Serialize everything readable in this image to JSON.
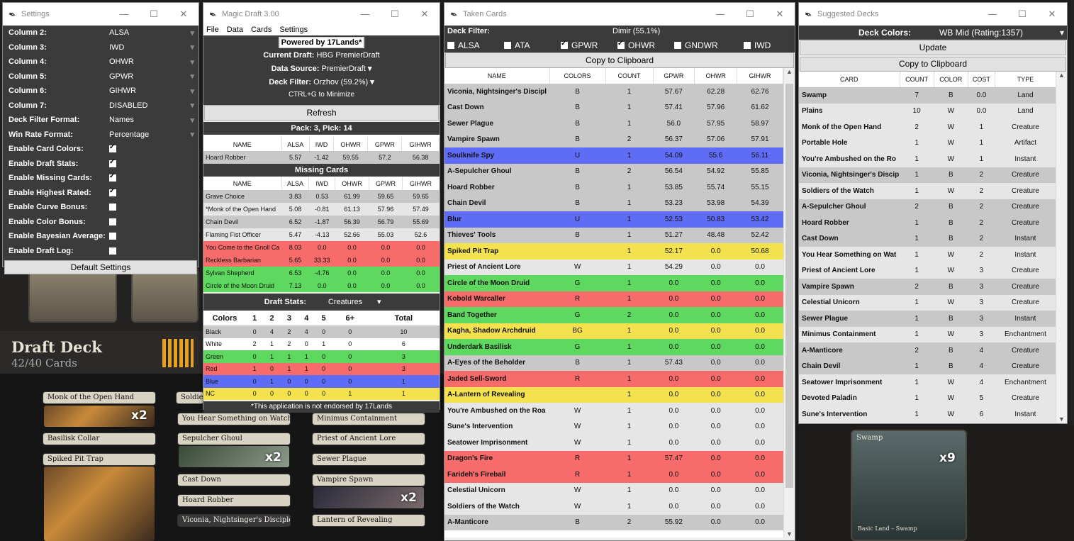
{
  "settings": {
    "title": "Settings",
    "rows": [
      {
        "k": "Column 2:",
        "v": "ALSA"
      },
      {
        "k": "Column 3:",
        "v": "IWD"
      },
      {
        "k": "Column 4:",
        "v": "OHWR"
      },
      {
        "k": "Column 5:",
        "v": "GPWR"
      },
      {
        "k": "Column 6:",
        "v": "GIHWR"
      },
      {
        "k": "Column 7:",
        "v": "DISABLED"
      },
      {
        "k": "Deck Filter Format:",
        "v": "Names"
      },
      {
        "k": "Win Rate Format:",
        "v": "Percentage"
      }
    ],
    "checks": [
      {
        "k": "Enable Card Colors:",
        "on": true
      },
      {
        "k": "Enable Draft Stats:",
        "on": true
      },
      {
        "k": "Enable Missing Cards:",
        "on": true
      },
      {
        "k": "Enable Highest Rated:",
        "on": true
      },
      {
        "k": "Enable Curve Bonus:",
        "on": false
      },
      {
        "k": "Enable Color Bonus:",
        "on": false
      },
      {
        "k": "Enable Bayesian Average:",
        "on": false
      },
      {
        "k": "Enable Draft Log:",
        "on": false
      }
    ],
    "default_button": "Default Settings"
  },
  "magic": {
    "title": "Magic Draft 3.00",
    "menu": [
      "File",
      "Data",
      "Cards",
      "Settings"
    ],
    "powered": "Powered by 17Lands*",
    "current_draft_label": "Current Draft:",
    "current_draft": "HBG PremierDraft",
    "data_source_label": "Data Source:",
    "data_source": "PremierDraft",
    "deck_filter_label": "Deck Filter:",
    "deck_filter": "Orzhov (59.2%)",
    "minimize_hint": "CTRL+G to Minimize",
    "refresh": "Refresh",
    "pack_pick": "Pack: 3, Pick: 14",
    "headers": [
      "NAME",
      "ALSA",
      "IWD",
      "OHWR",
      "GPWR",
      "GIHWR"
    ],
    "pack_rows": [
      {
        "c": "gray",
        "v": [
          "Hoard Robber",
          "5.57",
          "-1.42",
          "59.55",
          "57.2",
          "56.38"
        ]
      }
    ],
    "missing_title": "Missing Cards",
    "missing_rows": [
      {
        "c": "gray",
        "v": [
          "Grave Choice",
          "3.83",
          "0.53",
          "61.99",
          "59.65",
          "59.65"
        ]
      },
      {
        "c": "lg",
        "v": [
          "*Monk of the Open Hand",
          "5.08",
          "-0.81",
          "61.13",
          "57.96",
          "57.49"
        ]
      },
      {
        "c": "gray",
        "v": [
          "Chain Devil",
          "6.52",
          "-1.87",
          "56.39",
          "56.79",
          "55.69"
        ]
      },
      {
        "c": "lg",
        "v": [
          "Flaming Fist Officer",
          "5.47",
          "-4.13",
          "52.66",
          "55.03",
          "52.6"
        ]
      },
      {
        "c": "red",
        "v": [
          "You Come to the Gnoll Ca",
          "8.03",
          "0.0",
          "0.0",
          "0.0",
          "0.0"
        ]
      },
      {
        "c": "red",
        "v": [
          "Reckless Barbarian",
          "5.65",
          "33.33",
          "0.0",
          "0.0",
          "0.0"
        ]
      },
      {
        "c": "grn",
        "v": [
          "Sylvan Shepherd",
          "6.53",
          "-4.76",
          "0.0",
          "0.0",
          "0.0"
        ]
      },
      {
        "c": "grn",
        "v": [
          "Circle of the Moon Druid",
          "7.13",
          "0.0",
          "0.0",
          "0.0",
          "0.0"
        ]
      }
    ],
    "stats_label": "Draft Stats:",
    "stats_filter": "Creatures",
    "stats_headers": [
      "Colors",
      "1",
      "2",
      "3",
      "4",
      "5",
      "6+",
      "Total"
    ],
    "stats_rows": [
      {
        "c": "gray",
        "v": [
          "Black",
          "0",
          "4",
          "2",
          "4",
          "0",
          "0",
          "10"
        ]
      },
      {
        "c": "wh",
        "v": [
          "White",
          "2",
          "1",
          "2",
          "0",
          "1",
          "0",
          "6"
        ]
      },
      {
        "c": "grn",
        "v": [
          "Green",
          "0",
          "1",
          "1",
          "1",
          "0",
          "0",
          "3"
        ]
      },
      {
        "c": "red",
        "v": [
          "Red",
          "1",
          "0",
          "1",
          "1",
          "0",
          "0",
          "3"
        ]
      },
      {
        "c": "blu",
        "v": [
          "Blue",
          "0",
          "1",
          "0",
          "0",
          "0",
          "0",
          "1"
        ]
      },
      {
        "c": "yel",
        "v": [
          "NC",
          "0",
          "0",
          "0",
          "0",
          "0",
          "1",
          "1"
        ]
      }
    ],
    "footer": "*This application is not endorsed by 17Lands"
  },
  "taken": {
    "title": "Taken Cards",
    "deck_filter_label": "Deck Filter:",
    "deck_filter": "Dimir (55.1%)",
    "toggles": [
      {
        "k": "ALSA",
        "on": false
      },
      {
        "k": "ATA",
        "on": false
      },
      {
        "k": "GPWR",
        "on": true
      },
      {
        "k": "OHWR",
        "on": true
      },
      {
        "k": "GNDWR",
        "on": false
      },
      {
        "k": "IWD",
        "on": false
      }
    ],
    "copy": "Copy to Clipboard",
    "headers": [
      "NAME",
      "COLORS",
      "COUNT",
      "GPWR",
      "OHWR",
      "GIHWR"
    ],
    "rows": [
      {
        "c": "gray",
        "v": [
          "Viconia, Nightsinger's Discipl",
          "B",
          "1",
          "57.67",
          "62.28",
          "62.76"
        ]
      },
      {
        "c": "gray",
        "v": [
          "Cast Down",
          "B",
          "1",
          "57.41",
          "57.96",
          "61.62"
        ]
      },
      {
        "c": "gray",
        "v": [
          "Sewer Plague",
          "B",
          "1",
          "56.0",
          "57.95",
          "58.97"
        ]
      },
      {
        "c": "gray",
        "v": [
          "Vampire Spawn",
          "B",
          "2",
          "56.37",
          "57.06",
          "57.91"
        ]
      },
      {
        "c": "blu",
        "v": [
          "Soulknife Spy",
          "U",
          "1",
          "54.09",
          "55.6",
          "56.11"
        ]
      },
      {
        "c": "gray",
        "v": [
          "A-Sepulcher Ghoul",
          "B",
          "2",
          "56.54",
          "54.92",
          "55.85"
        ]
      },
      {
        "c": "gray",
        "v": [
          "Hoard Robber",
          "B",
          "1",
          "53.85",
          "55.74",
          "55.15"
        ]
      },
      {
        "c": "gray",
        "v": [
          "Chain Devil",
          "B",
          "1",
          "53.23",
          "53.98",
          "54.39"
        ]
      },
      {
        "c": "blu",
        "v": [
          "Blur",
          "U",
          "1",
          "52.53",
          "50.83",
          "53.42"
        ]
      },
      {
        "c": "gray",
        "v": [
          "Thieves' Tools",
          "B",
          "1",
          "51.27",
          "48.48",
          "52.42"
        ]
      },
      {
        "c": "yel",
        "v": [
          "Spiked Pit Trap",
          "",
          "1",
          "52.17",
          "0.0",
          "50.68"
        ]
      },
      {
        "c": "lg",
        "v": [
          "Priest of Ancient Lore",
          "W",
          "1",
          "54.29",
          "0.0",
          "0.0"
        ]
      },
      {
        "c": "grn",
        "v": [
          "Circle of the Moon Druid",
          "G",
          "1",
          "0.0",
          "0.0",
          "0.0"
        ]
      },
      {
        "c": "red",
        "v": [
          "Kobold Warcaller",
          "R",
          "1",
          "0.0",
          "0.0",
          "0.0"
        ]
      },
      {
        "c": "grn",
        "v": [
          "Band Together",
          "G",
          "2",
          "0.0",
          "0.0",
          "0.0"
        ]
      },
      {
        "c": "yel",
        "v": [
          "Kagha, Shadow Archdruid",
          "BG",
          "1",
          "0.0",
          "0.0",
          "0.0"
        ]
      },
      {
        "c": "grn",
        "v": [
          "Underdark Basilisk",
          "G",
          "1",
          "0.0",
          "0.0",
          "0.0"
        ]
      },
      {
        "c": "gray",
        "v": [
          "A-Eyes of the Beholder",
          "B",
          "1",
          "57.43",
          "0.0",
          "0.0"
        ]
      },
      {
        "c": "red",
        "v": [
          "Jaded Sell-Sword",
          "R",
          "1",
          "0.0",
          "0.0",
          "0.0"
        ]
      },
      {
        "c": "yel",
        "v": [
          "A-Lantern of Revealing",
          "",
          "1",
          "0.0",
          "0.0",
          "0.0"
        ]
      },
      {
        "c": "lg",
        "v": [
          "You're Ambushed on the Roa",
          "W",
          "1",
          "0.0",
          "0.0",
          "0.0"
        ]
      },
      {
        "c": "lg",
        "v": [
          "Sune's Intervention",
          "W",
          "1",
          "0.0",
          "0.0",
          "0.0"
        ]
      },
      {
        "c": "lg",
        "v": [
          "Seatower Imprisonment",
          "W",
          "1",
          "0.0",
          "0.0",
          "0.0"
        ]
      },
      {
        "c": "red",
        "v": [
          "Dragon's Fire",
          "R",
          "1",
          "57.47",
          "0.0",
          "0.0"
        ]
      },
      {
        "c": "red",
        "v": [
          "Farideh's Fireball",
          "R",
          "1",
          "0.0",
          "0.0",
          "0.0"
        ]
      },
      {
        "c": "lg",
        "v": [
          "Celestial Unicorn",
          "W",
          "1",
          "0.0",
          "0.0",
          "0.0"
        ]
      },
      {
        "c": "lg",
        "v": [
          "Soldiers of the Watch",
          "W",
          "1",
          "0.0",
          "0.0",
          "0.0"
        ]
      },
      {
        "c": "gray",
        "v": [
          "A-Manticore",
          "B",
          "2",
          "55.92",
          "0.0",
          "0.0"
        ]
      }
    ]
  },
  "suggested": {
    "title": "Suggested Decks",
    "colors_label": "Deck Colors:",
    "colors": "WB Mid (Rating:1357)",
    "update": "Update",
    "copy": "Copy to Clipboard",
    "headers": [
      "CARD",
      "COUNT",
      "COLOR",
      "COST",
      "TYPE"
    ],
    "rows": [
      {
        "c": "gray",
        "v": [
          "Swamp",
          "7",
          "B",
          "0.0",
          "Land"
        ]
      },
      {
        "c": "lg",
        "v": [
          "Plains",
          "10",
          "W",
          "0.0",
          "Land"
        ]
      },
      {
        "c": "lg",
        "v": [
          "Monk of the Open Hand",
          "2",
          "W",
          "1",
          "Creature"
        ]
      },
      {
        "c": "lg",
        "v": [
          "Portable Hole",
          "1",
          "W",
          "1",
          "Artifact"
        ]
      },
      {
        "c": "lg",
        "v": [
          "You're Ambushed on the Ro",
          "1",
          "W",
          "1",
          "Instant"
        ]
      },
      {
        "c": "gray",
        "v": [
          "Viconia, Nightsinger's Discip",
          "1",
          "B",
          "2",
          "Creature"
        ]
      },
      {
        "c": "lg",
        "v": [
          "Soldiers of the Watch",
          "1",
          "W",
          "2",
          "Creature"
        ]
      },
      {
        "c": "gray",
        "v": [
          "A-Sepulcher Ghoul",
          "2",
          "B",
          "2",
          "Creature"
        ]
      },
      {
        "c": "gray",
        "v": [
          "Hoard Robber",
          "1",
          "B",
          "2",
          "Creature"
        ]
      },
      {
        "c": "gray",
        "v": [
          "Cast Down",
          "1",
          "B",
          "2",
          "Instant"
        ]
      },
      {
        "c": "lg",
        "v": [
          "You Hear Something on Wat",
          "1",
          "W",
          "2",
          "Instant"
        ]
      },
      {
        "c": "lg",
        "v": [
          "Priest of Ancient Lore",
          "1",
          "W",
          "3",
          "Creature"
        ]
      },
      {
        "c": "gray",
        "v": [
          "Vampire Spawn",
          "2",
          "B",
          "3",
          "Creature"
        ]
      },
      {
        "c": "lg",
        "v": [
          "Celestial Unicorn",
          "1",
          "W",
          "3",
          "Creature"
        ]
      },
      {
        "c": "gray",
        "v": [
          "Sewer Plague",
          "1",
          "B",
          "3",
          "Instant"
        ]
      },
      {
        "c": "lg",
        "v": [
          "Minimus Containment",
          "1",
          "W",
          "3",
          "Enchantment"
        ]
      },
      {
        "c": "gray",
        "v": [
          "A-Manticore",
          "2",
          "B",
          "4",
          "Creature"
        ]
      },
      {
        "c": "gray",
        "v": [
          "Chain Devil",
          "1",
          "B",
          "4",
          "Creature"
        ]
      },
      {
        "c": "lg",
        "v": [
          "Seatower Imprisonment",
          "1",
          "W",
          "4",
          "Enchantment"
        ]
      },
      {
        "c": "lg",
        "v": [
          "Devoted Paladin",
          "1",
          "W",
          "5",
          "Creature"
        ]
      },
      {
        "c": "lg",
        "v": [
          "Sune's Intervention",
          "1",
          "W",
          "6",
          "Instant"
        ]
      }
    ]
  },
  "background": {
    "deck_title": "Draft Deck",
    "deck_count": "42/40 Cards",
    "strips": [
      "Monk of the Open Hand",
      "Basilisk Collar",
      "Spiked Pit Trap",
      "Soldiers",
      "You Hear Something on Watch",
      "Sepulcher Ghoul",
      "Cast Down",
      "Hoard Robber",
      "Viconia, Nightsinger's Disciple",
      "Minimus Containment",
      "Priest of Ancient Lore",
      "Sewer Plague",
      "Vampire Spawn",
      "Lantern of Revealing",
      "Swamp",
      "Basic Land – Swamp"
    ],
    "x2": "x2",
    "x9": "x9"
  }
}
